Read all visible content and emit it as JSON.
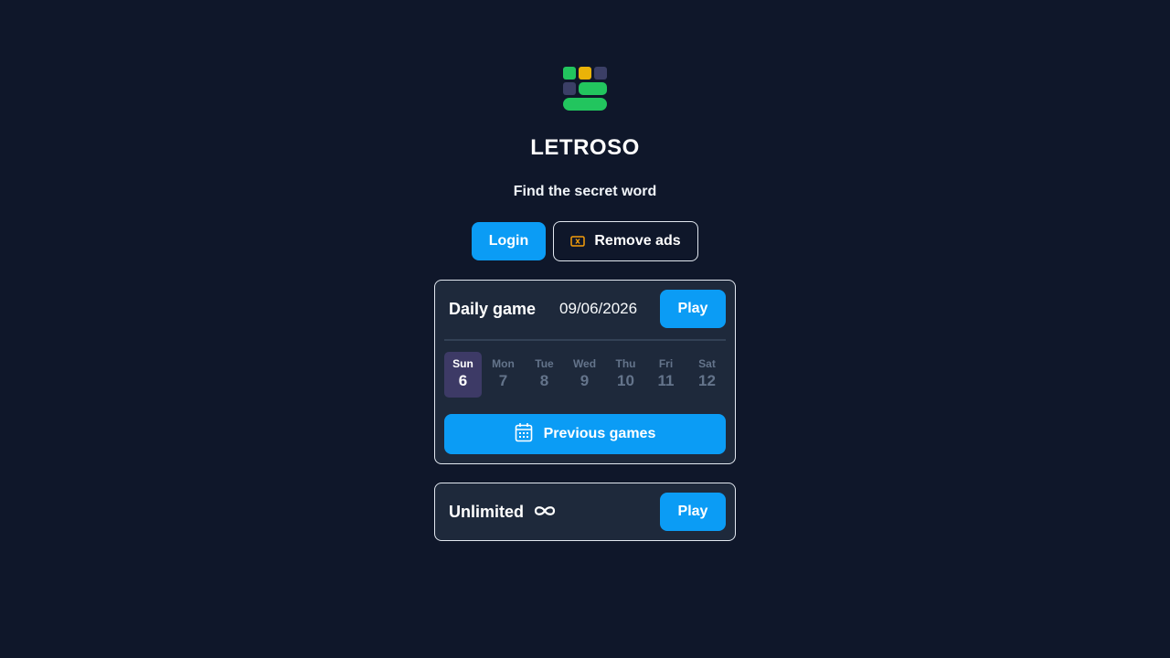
{
  "app": {
    "title": "LETROSO",
    "subtitle": "Find the secret word",
    "logo_colors": {
      "green": "#22c55e",
      "yellow": "#eab308",
      "slate": "#334155"
    }
  },
  "header": {
    "login_label": "Login",
    "remove_ads_label": "Remove ads",
    "remove_ads_icon": "ticket-icon"
  },
  "daily": {
    "title": "Daily game",
    "date": "09/06/2026",
    "play_label": "Play",
    "days": [
      {
        "name": "Sun",
        "num": "6",
        "active": true
      },
      {
        "name": "Mon",
        "num": "7",
        "active": false
      },
      {
        "name": "Tue",
        "num": "8",
        "active": false
      },
      {
        "name": "Wed",
        "num": "9",
        "active": false
      },
      {
        "name": "Thu",
        "num": "10",
        "active": false
      },
      {
        "name": "Fri",
        "num": "11",
        "active": false
      },
      {
        "name": "Sat",
        "num": "12",
        "active": false
      }
    ],
    "previous_label": "Previous games",
    "previous_icon": "calendar-icon"
  },
  "unlimited": {
    "title": "Unlimited",
    "title_icon": "infinity-icon",
    "play_label": "Play"
  },
  "colors": {
    "background": "#0f172a",
    "card": "#1e293b",
    "accent": "#0b9cf5",
    "active_day": "#3d3a66",
    "ticket": "#f59e0b"
  }
}
